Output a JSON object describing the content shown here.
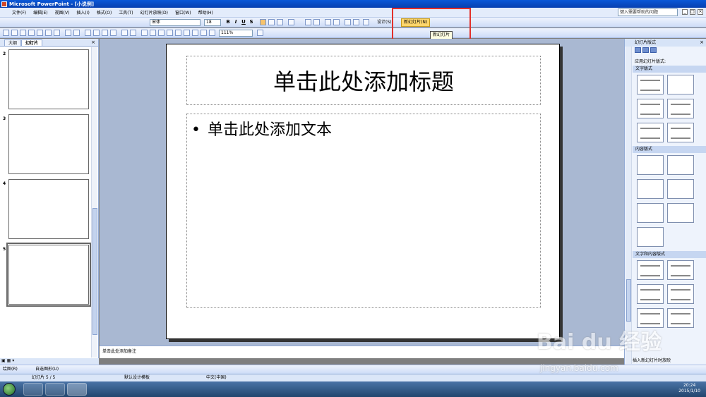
{
  "window": {
    "title": "Microsoft PowerPoint - [小说例]"
  },
  "menu": {
    "items": [
      "文件(F)",
      "编辑(E)",
      "视图(V)",
      "插入(I)",
      "格式(O)",
      "工具(T)",
      "幻灯片放映(D)",
      "窗口(W)",
      "帮助(H)"
    ],
    "help_search_placeholder": "键入需要帮助的问题"
  },
  "toolbar": {
    "font_name": "宋体",
    "font_size": "18",
    "zoom": "111%",
    "bold": "B",
    "italic": "I",
    "underline": "U",
    "shadow": "S",
    "design_label": "设计(S)",
    "new_slide_label": "新幻灯片(N)",
    "tooltip": "新幻灯片"
  },
  "left_pane": {
    "tabs": [
      "大纲",
      "幻灯片"
    ],
    "close": "×",
    "slide_numbers": [
      "2",
      "3",
      "4",
      "5"
    ]
  },
  "slide": {
    "title_placeholder": "单击此处添加标题",
    "body_placeholder": "单击此处添加文本",
    "bullet": "•"
  },
  "notes": {
    "placeholder": "单击此处添加备注"
  },
  "task_pane": {
    "title": "幻灯片版式",
    "close": "×",
    "apply_label": "应用幻灯片版式:",
    "sections": [
      "文字版式",
      "内容版式",
      "文字和内容版式"
    ],
    "footer": "插入新幻灯片时放映"
  },
  "drawing_toolbar": {
    "draw_label": "绘图(R)",
    "autoshapes_label": "自选图形(U)"
  },
  "status": {
    "slide_count": "幻灯片 5 / 5",
    "template": "默认设计模板",
    "language": "中文(中国)"
  },
  "tray": {
    "time": "20:24",
    "date": "2015/1/10"
  },
  "watermark": {
    "logo": "Bai du 经验",
    "url": "jingyan.baidu.com"
  }
}
